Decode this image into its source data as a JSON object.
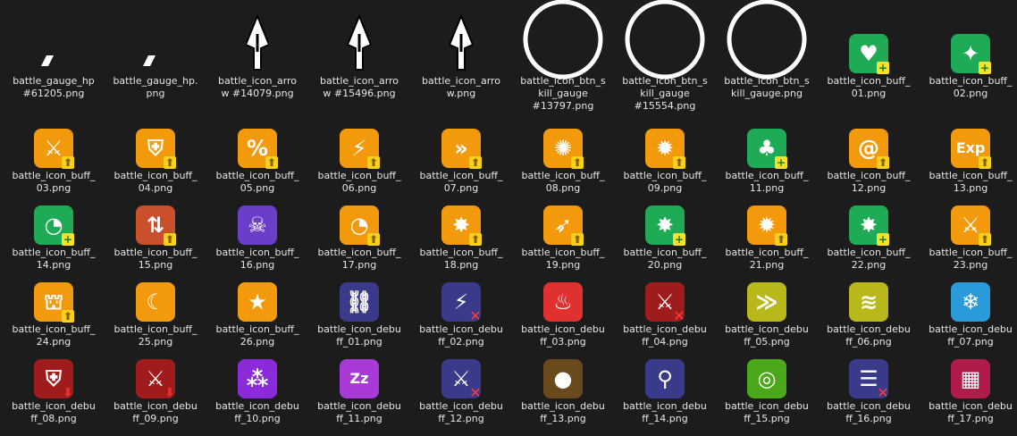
{
  "files": [
    {
      "label": "battle_gauge_hp\n#61205.png",
      "icon": "gauge-hp-icon",
      "kind": "slash"
    },
    {
      "label": "battle_gauge_hp.\npng",
      "icon": "gauge-hp-icon",
      "kind": "slash"
    },
    {
      "label": "battle_icon_arro\nw #14079.png",
      "icon": "arrow-icon",
      "kind": "arrow"
    },
    {
      "label": "battle_icon_arro\nw #15496.png",
      "icon": "arrow-icon",
      "kind": "arrow"
    },
    {
      "label": "battle_icon_arro\nw.png",
      "icon": "arrow-icon",
      "kind": "arrow"
    },
    {
      "label": "battle_icon_btn_s\nkill_gauge\n#13797.png",
      "icon": "skill-gauge-ring-icon",
      "kind": "ring"
    },
    {
      "label": "battle_icon_btn_s\nkill_gauge\n#15554.png",
      "icon": "skill-gauge-ring-icon",
      "kind": "ring"
    },
    {
      "label": "battle_icon_btn_s\nkill_gauge.png",
      "icon": "skill-gauge-ring-icon",
      "kind": "ring"
    },
    {
      "label": "battle_icon_buff_\n01.png",
      "icon": "heart-buff-icon",
      "kind": "tile",
      "bg": "#1faa55",
      "glyph": "♥",
      "badge": "plus"
    },
    {
      "label": "battle_icon_buff_\n02.png",
      "icon": "sparkle-buff-icon",
      "kind": "tile",
      "bg": "#1faa55",
      "glyph": "✦",
      "badge": "plus"
    },
    {
      "label": "battle_icon_buff_\n03.png",
      "icon": "sword-buff-icon",
      "kind": "tile",
      "bg": "#f39a0c",
      "glyph": "⚔",
      "badge": "up"
    },
    {
      "label": "battle_icon_buff_\n04.png",
      "icon": "shield-buff-icon",
      "kind": "tile",
      "bg": "#f39a0c",
      "glyph": "⛨",
      "badge": "up"
    },
    {
      "label": "battle_icon_buff_\n05.png",
      "icon": "crit-arrow-buff-icon",
      "kind": "tile",
      "bg": "#f39a0c",
      "glyph": "%",
      "badge": "up"
    },
    {
      "label": "battle_icon_buff_\n06.png",
      "icon": "lightning-buff-icon",
      "kind": "tile",
      "bg": "#f39a0c",
      "glyph": "⚡",
      "badge": "up"
    },
    {
      "label": "battle_icon_buff_\n07.png",
      "icon": "speed-buff-icon",
      "kind": "tile",
      "bg": "#f39a0c",
      "glyph": "»",
      "badge": "up"
    },
    {
      "label": "battle_icon_buff_\n08.png",
      "icon": "sword-gear-buff-icon",
      "kind": "tile",
      "bg": "#f39a0c",
      "glyph": "✺",
      "badge": "up"
    },
    {
      "label": "battle_icon_buff_\n09.png",
      "icon": "shield-gear-buff-icon",
      "kind": "tile",
      "bg": "#f39a0c",
      "glyph": "✹",
      "badge": "up"
    },
    {
      "label": "battle_icon_buff_\n11.png",
      "icon": "clover-buff-icon",
      "kind": "tile",
      "bg": "#1faa55",
      "glyph": "♣",
      "badge": "plus"
    },
    {
      "label": "battle_icon_buff_\n12.png",
      "icon": "spiral-buff-icon",
      "kind": "tile",
      "bg": "#f39a0c",
      "glyph": "@",
      "badge": "up"
    },
    {
      "label": "battle_icon_buff_\n13.png",
      "icon": "exp-buff-icon",
      "kind": "tile",
      "bg": "#f39a0c",
      "glyph": "Exp",
      "badge": "up"
    },
    {
      "label": "battle_icon_buff_\n14.png",
      "icon": "wave-buff-icon",
      "kind": "tile",
      "bg": "#1faa55",
      "glyph": "◔",
      "badge": "plus"
    },
    {
      "label": "battle_icon_buff_\n15.png",
      "icon": "swap-buff-icon",
      "kind": "tile",
      "bg": "#c8502a",
      "glyph": "⇅",
      "badge": "up"
    },
    {
      "label": "battle_icon_buff_\n16.png",
      "icon": "skull-buff-icon",
      "kind": "tile",
      "bg": "#6a3ec8",
      "glyph": "☠",
      "badge": ""
    },
    {
      "label": "battle_icon_buff_\n17.png",
      "icon": "wave-buff-icon",
      "kind": "tile",
      "bg": "#f39a0c",
      "glyph": "◔",
      "badge": "up"
    },
    {
      "label": "battle_icon_buff_\n18.png",
      "icon": "burst-buff-icon",
      "kind": "tile",
      "bg": "#f39a0c",
      "glyph": "✸",
      "badge": "up"
    },
    {
      "label": "battle_icon_buff_\n19.png",
      "icon": "arrow-burst-buff-icon",
      "kind": "tile",
      "bg": "#f39a0c",
      "glyph": "➶",
      "badge": "up"
    },
    {
      "label": "battle_icon_buff_\n20.png",
      "icon": "burst-buff-icon",
      "kind": "tile",
      "bg": "#1faa55",
      "glyph": "✸",
      "badge": "plus"
    },
    {
      "label": "battle_icon_buff_\n21.png",
      "icon": "gear-arrow-buff-icon",
      "kind": "tile",
      "bg": "#f39a0c",
      "glyph": "✹",
      "badge": "up"
    },
    {
      "label": "battle_icon_buff_\n22.png",
      "icon": "burst-buff-icon",
      "kind": "tile",
      "bg": "#1faa55",
      "glyph": "✸",
      "badge": "plus"
    },
    {
      "label": "battle_icon_buff_\n23.png",
      "icon": "sword-buff-icon",
      "kind": "tile",
      "bg": "#f39a0c",
      "glyph": "⚔",
      "badge": "up"
    },
    {
      "label": "battle_icon_buff_\n24.png",
      "icon": "armor-buff-icon",
      "kind": "tile",
      "bg": "#f39a0c",
      "glyph": "⛫",
      "badge": "up"
    },
    {
      "label": "battle_icon_buff_\n25.png",
      "icon": "crescent-buff-icon",
      "kind": "tile",
      "bg": "#f39a0c",
      "glyph": "☾",
      "badge": ""
    },
    {
      "label": "battle_icon_buff_\n26.png",
      "icon": "star-shield-buff-icon",
      "kind": "tile",
      "bg": "#f39a0c",
      "glyph": "★",
      "badge": ""
    },
    {
      "label": "battle_icon_debu\nff_01.png",
      "icon": "chain-debuff-icon",
      "kind": "tile",
      "bg": "#3a3a8a",
      "glyph": "⛓",
      "badge": ""
    },
    {
      "label": "battle_icon_debu\nff_02.png",
      "icon": "lightning-debuff-icon",
      "kind": "tile",
      "bg": "#3a3a8a",
      "glyph": "⚡",
      "badge": "x"
    },
    {
      "label": "battle_icon_debu\nff_03.png",
      "icon": "fire-debuff-icon",
      "kind": "tile",
      "bg": "#e03030",
      "glyph": "♨",
      "badge": ""
    },
    {
      "label": "battle_icon_debu\nff_04.png",
      "icon": "sword-debuff-icon",
      "kind": "tile",
      "bg": "#a01c1c",
      "glyph": "⚔",
      "badge": "x"
    },
    {
      "label": "battle_icon_debu\nff_05.png",
      "icon": "chevron-debuff-icon",
      "kind": "tile",
      "bg": "#b8b81a",
      "glyph": "≫",
      "badge": ""
    },
    {
      "label": "battle_icon_debu\nff_06.png",
      "icon": "wave-debuff-icon",
      "kind": "tile",
      "bg": "#b8b81a",
      "glyph": "≋",
      "badge": ""
    },
    {
      "label": "battle_icon_debu\nff_07.png",
      "icon": "snowflake-debuff-icon",
      "kind": "tile",
      "bg": "#2a9ad8",
      "glyph": "❄",
      "badge": ""
    },
    {
      "label": "battle_icon_debu\nff_08.png",
      "icon": "shield-debuff-icon",
      "kind": "tile",
      "bg": "#a01c1c",
      "glyph": "⛨",
      "badge": "down"
    },
    {
      "label": "battle_icon_debu\nff_09.png",
      "icon": "sword-debuff-icon",
      "kind": "tile",
      "bg": "#a01c1c",
      "glyph": "⚔",
      "badge": "down"
    },
    {
      "label": "battle_icon_debu\nff_10.png",
      "icon": "poison-debuff-icon",
      "kind": "tile",
      "bg": "#8a2ad8",
      "glyph": "⁂",
      "badge": ""
    },
    {
      "label": "battle_icon_debu\nff_11.png",
      "icon": "sleep-debuff-icon",
      "kind": "tile",
      "bg": "#a83ad8",
      "glyph": "Zz",
      "badge": ""
    },
    {
      "label": "battle_icon_debu\nff_12.png",
      "icon": "sword-debuff-icon",
      "kind": "tile",
      "bg": "#3a3a8a",
      "glyph": "⚔",
      "badge": "x"
    },
    {
      "label": "battle_icon_debu\nff_13.png",
      "icon": "rock-debuff-icon",
      "kind": "tile",
      "bg": "#6a4a1c",
      "glyph": "●",
      "badge": ""
    },
    {
      "label": "battle_icon_debu\nff_14.png",
      "icon": "bound-debuff-icon",
      "kind": "tile",
      "bg": "#3a3a8a",
      "glyph": "⚲",
      "badge": ""
    },
    {
      "label": "battle_icon_debu\nff_15.png",
      "icon": "spiral-debuff-icon",
      "kind": "tile",
      "bg": "#4aa81a",
      "glyph": "◎",
      "badge": ""
    },
    {
      "label": "battle_icon_debu\nff_16.png",
      "icon": "silence-debuff-icon",
      "kind": "tile",
      "bg": "#3a3a8a",
      "glyph": "☰",
      "badge": "x"
    },
    {
      "label": "battle_icon_debu\nff_17.png",
      "icon": "blocks-debuff-icon",
      "kind": "tile",
      "bg": "#b01c4a",
      "glyph": "▦",
      "badge": ""
    }
  ]
}
